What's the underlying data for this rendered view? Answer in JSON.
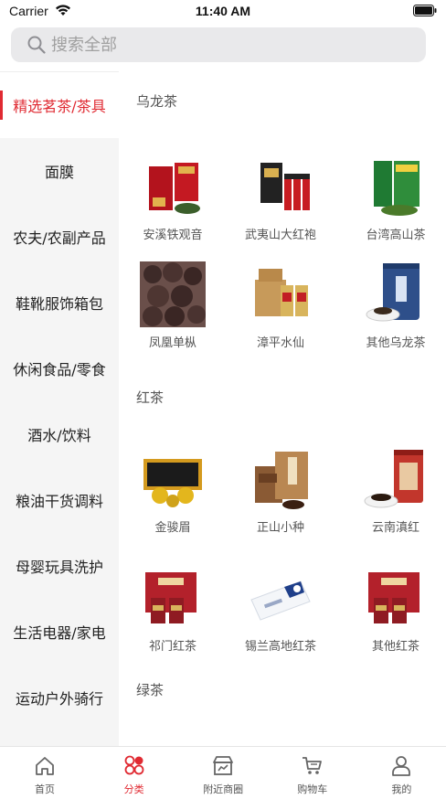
{
  "status_bar": {
    "carrier": "Carrier",
    "time": "11:40 AM"
  },
  "search": {
    "placeholder": "搜索全部"
  },
  "sidebar": {
    "items": [
      {
        "label": "精选茗茶/茶具",
        "active": true
      },
      {
        "label": "面膜"
      },
      {
        "label": "农夫/农副产品"
      },
      {
        "label": "鞋靴服饰箱包"
      },
      {
        "label": "休闲食品/零食"
      },
      {
        "label": "酒水/饮料"
      },
      {
        "label": "粮油干货调料"
      },
      {
        "label": "母婴玩具洗护"
      },
      {
        "label": "生活电器/家电"
      },
      {
        "label": "运动户外骑行"
      }
    ]
  },
  "sections": [
    {
      "title": "乌龙茶",
      "products": [
        {
          "label": "安溪铁观音",
          "icon": "tea-box-red-icon"
        },
        {
          "label": "武夷山大红袍",
          "icon": "tea-box-black-icon"
        },
        {
          "label": "台湾高山茶",
          "icon": "tea-box-green-icon"
        },
        {
          "label": "凤凰单枞",
          "icon": "tea-leaves-icon"
        },
        {
          "label": "漳平水仙",
          "icon": "tea-box-kraft-icon"
        },
        {
          "label": "其他乌龙茶",
          "icon": "tea-tin-blue-icon"
        }
      ]
    },
    {
      "title": "红茶",
      "products": [
        {
          "label": "金骏眉",
          "icon": "tea-set-gold-icon"
        },
        {
          "label": "正山小种",
          "icon": "tea-box-brown-icon"
        },
        {
          "label": "云南滇红",
          "icon": "tea-tin-red-icon"
        },
        {
          "label": "祁门红茶",
          "icon": "tea-gift-red-icon"
        },
        {
          "label": "锡兰高地红茶",
          "icon": "tea-box-white-icon"
        },
        {
          "label": "其他红茶",
          "icon": "tea-gift-red-icon"
        }
      ]
    },
    {
      "title": "绿茶",
      "products": []
    }
  ],
  "tabbar": {
    "items": [
      {
        "label": "首页",
        "icon": "home-icon"
      },
      {
        "label": "分类",
        "icon": "category-icon",
        "active": true
      },
      {
        "label": "附近商圈",
        "icon": "store-icon"
      },
      {
        "label": "购物车",
        "icon": "cart-icon"
      },
      {
        "label": "我的",
        "icon": "profile-icon"
      }
    ]
  },
  "colors": {
    "accent": "#e02a32",
    "sidebar_bg": "#f5f5f5",
    "search_bg": "#e9e9eb"
  }
}
